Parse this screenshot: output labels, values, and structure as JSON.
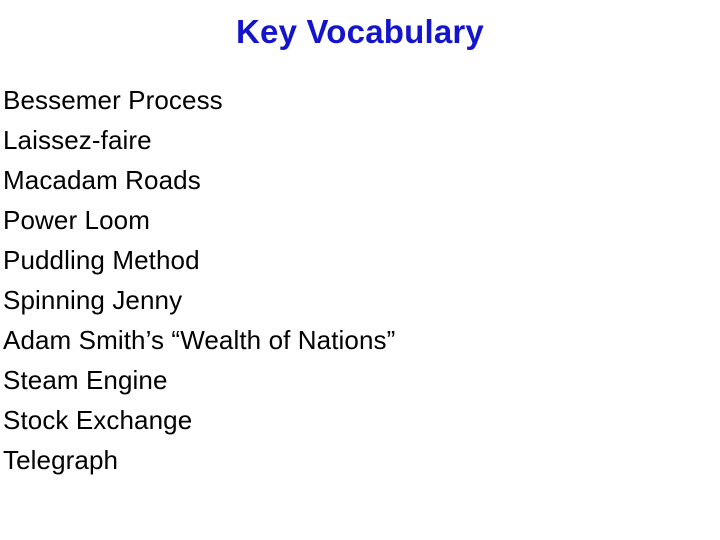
{
  "slide": {
    "title": "Key Vocabulary",
    "title_color": "#1414cd",
    "body_color": "#000000",
    "background_color": "#ffffff",
    "items": [
      {
        "label": "Bessemer Process"
      },
      {
        "label": "Laissez-faire"
      },
      {
        "label": "Macadam Roads"
      },
      {
        "label": "Power Loom"
      },
      {
        "label": "Puddling Method"
      },
      {
        "label": "Spinning Jenny"
      },
      {
        "label": "Adam Smith’s “Wealth of Nations”"
      },
      {
        "label": "Steam Engine"
      },
      {
        "label": "Stock Exchange"
      },
      {
        "label": "Telegraph"
      }
    ]
  }
}
